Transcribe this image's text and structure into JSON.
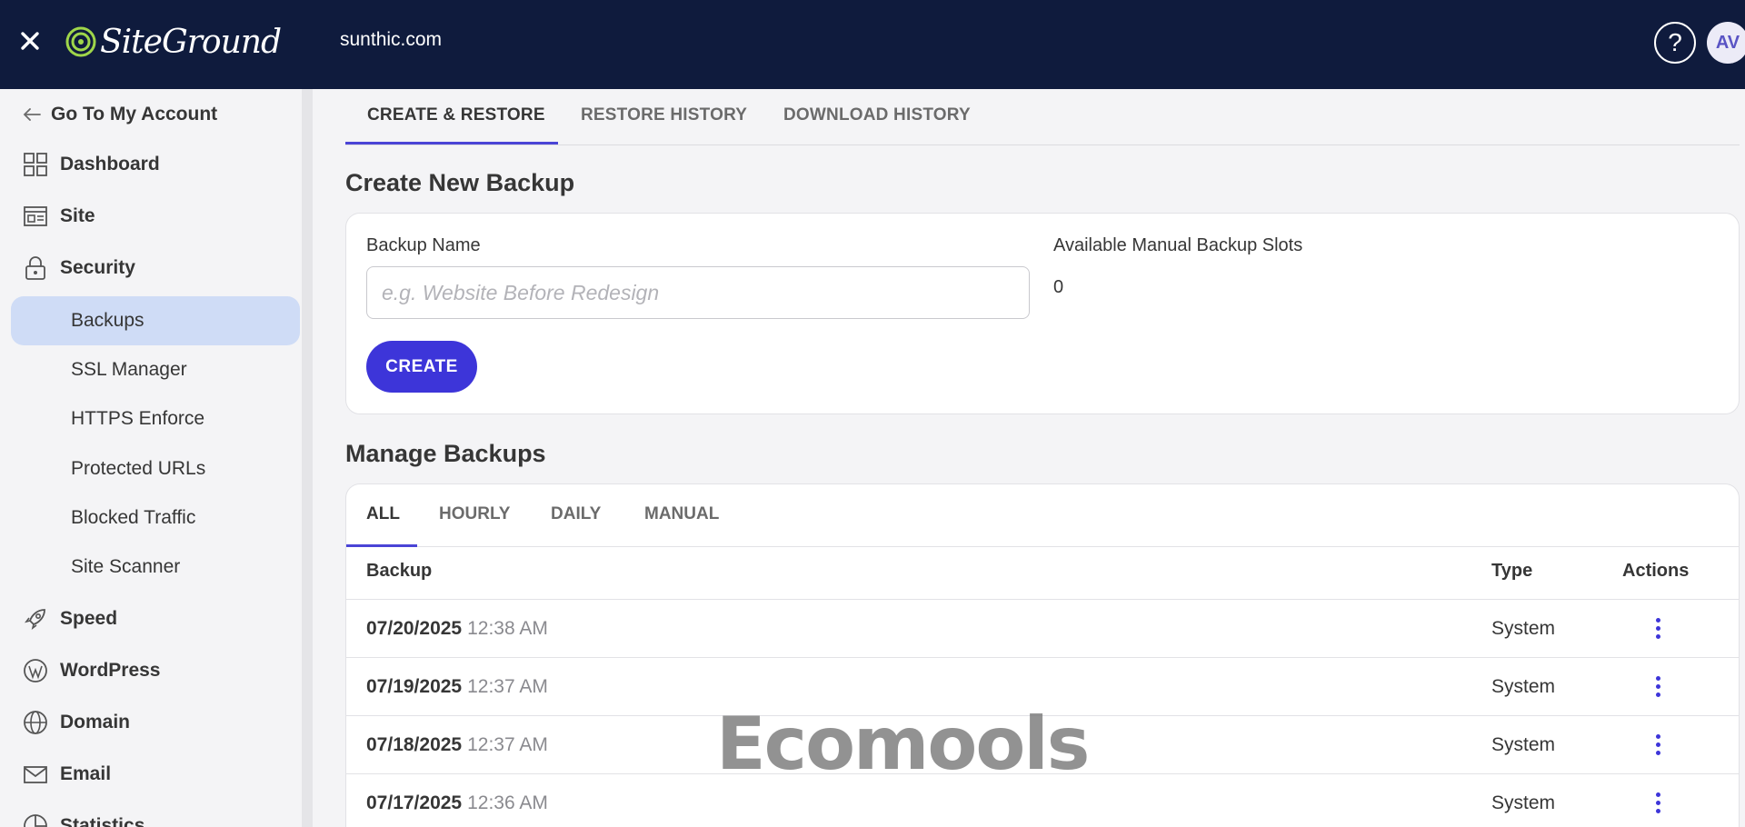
{
  "topbar": {
    "logo_text": "SiteGround",
    "domain": "sunthic.com",
    "help_symbol": "?",
    "avatar_initials": "AV",
    "background_color": "#0f1b3d"
  },
  "sidebar": {
    "back_label": "Go To My Account",
    "items": [
      {
        "label": "Dashboard",
        "icon": "grid-icon"
      },
      {
        "label": "Site",
        "icon": "site-icon"
      },
      {
        "label": "Security",
        "icon": "lock-icon"
      },
      {
        "label": "Speed",
        "icon": "rocket-icon"
      },
      {
        "label": "WordPress",
        "icon": "wordpress-icon"
      },
      {
        "label": "Domain",
        "icon": "globe-icon"
      },
      {
        "label": "Email",
        "icon": "mail-icon"
      },
      {
        "label": "Statistics",
        "icon": "chart-icon"
      }
    ],
    "security_sub": [
      {
        "label": "Backups",
        "active": true
      },
      {
        "label": "SSL Manager"
      },
      {
        "label": "HTTPS Enforce"
      },
      {
        "label": "Protected URLs"
      },
      {
        "label": "Blocked Traffic"
      },
      {
        "label": "Site Scanner"
      }
    ],
    "active_color": "#cfdcf6"
  },
  "main": {
    "tabs": [
      {
        "label": "CREATE & RESTORE",
        "active": true
      },
      {
        "label": "RESTORE HISTORY"
      },
      {
        "label": "DOWNLOAD HISTORY"
      }
    ],
    "create": {
      "title": "Create New Backup",
      "name_label": "Backup Name",
      "name_placeholder": "e.g. Website Before Redesign",
      "name_value": "",
      "slots_label": "Available Manual Backup Slots",
      "slots_value": "0",
      "button": "CREATE"
    },
    "manage": {
      "title": "Manage Backups",
      "filters": [
        {
          "label": "ALL",
          "active": true
        },
        {
          "label": "HOURLY"
        },
        {
          "label": "DAILY"
        },
        {
          "label": "MANUAL"
        }
      ],
      "columns": [
        "Backup",
        "Type",
        "Actions"
      ],
      "rows": [
        {
          "date": "07/20/2025",
          "time": "12:38 AM",
          "type": "System"
        },
        {
          "date": "07/19/2025",
          "time": "12:37 AM",
          "type": "System"
        },
        {
          "date": "07/18/2025",
          "time": "12:37 AM",
          "type": "System"
        },
        {
          "date": "07/17/2025",
          "time": "12:36 AM",
          "type": "System"
        }
      ]
    },
    "accent_color": "#3d35d9"
  },
  "watermark": {
    "text": "Ecomools"
  }
}
